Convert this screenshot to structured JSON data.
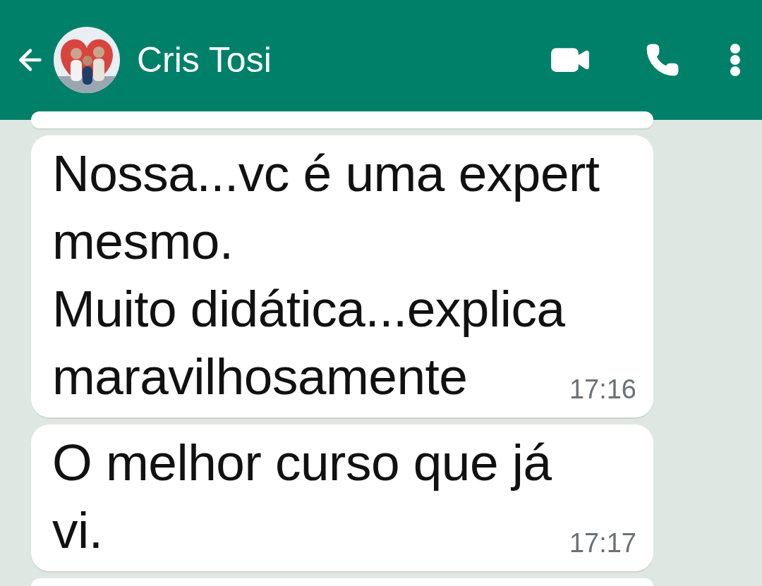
{
  "header": {
    "contact_name": "Cris Tosi"
  },
  "messages": [
    {
      "kind": "partial-top"
    },
    {
      "kind": "text",
      "lines": [
        "Nossa...vc é uma expert",
        "mesmo.",
        "Muito didática...explica",
        "maravilhosamente"
      ],
      "time": "17:16"
    },
    {
      "kind": "text",
      "lines": [
        "O melhor curso que já",
        "vi."
      ],
      "time": "17:17"
    },
    {
      "kind": "partial-bottom"
    }
  ]
}
